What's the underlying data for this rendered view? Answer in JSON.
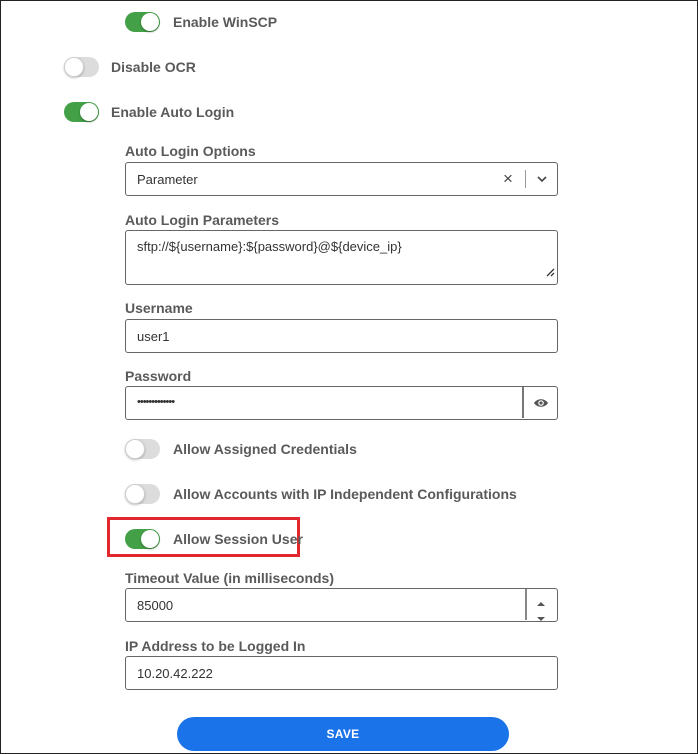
{
  "toggles": {
    "enable_winscp": {
      "label": "Enable WinSCP",
      "state": "on"
    },
    "disable_ocr": {
      "label": "Disable OCR",
      "state": "off"
    },
    "enable_auto_login": {
      "label": "Enable Auto Login",
      "state": "on"
    },
    "allow_assigned_credentials": {
      "label": "Allow Assigned Credentials",
      "state": "off"
    },
    "allow_accounts_ip_independent": {
      "label": "Allow Accounts with IP Independent Configurations",
      "state": "off"
    },
    "allow_session_user": {
      "label": "Allow Session User",
      "state": "on"
    }
  },
  "fields": {
    "auto_login_options": {
      "label": "Auto Login Options",
      "value": "Parameter",
      "clear_icon": "×"
    },
    "auto_login_parameters": {
      "label": "Auto Login Parameters",
      "value": "sftp://${username}:${password}@${device_ip}"
    },
    "username": {
      "label": "Username",
      "value": "user1"
    },
    "password": {
      "label": "Password",
      "value": "•••••••••••••"
    },
    "timeout": {
      "label": "Timeout Value (in milliseconds)",
      "value": "85000"
    },
    "ip_address": {
      "label": "IP Address to be Logged In",
      "value": "10.20.42.222"
    }
  },
  "save_button": {
    "label": "SAVE"
  },
  "colors": {
    "toggle_on": "#43a047",
    "toggle_off": "#dcdcdc",
    "save": "#1a73e8",
    "highlight": "#e0282e"
  },
  "icons": {
    "select_clear": "close-icon",
    "select_dropdown": "chevron-down-icon",
    "password_reveal": "eye-icon",
    "resize": "resize-grip-icon",
    "stepper_up": "caret-up-icon",
    "stepper_down": "caret-down-icon"
  }
}
